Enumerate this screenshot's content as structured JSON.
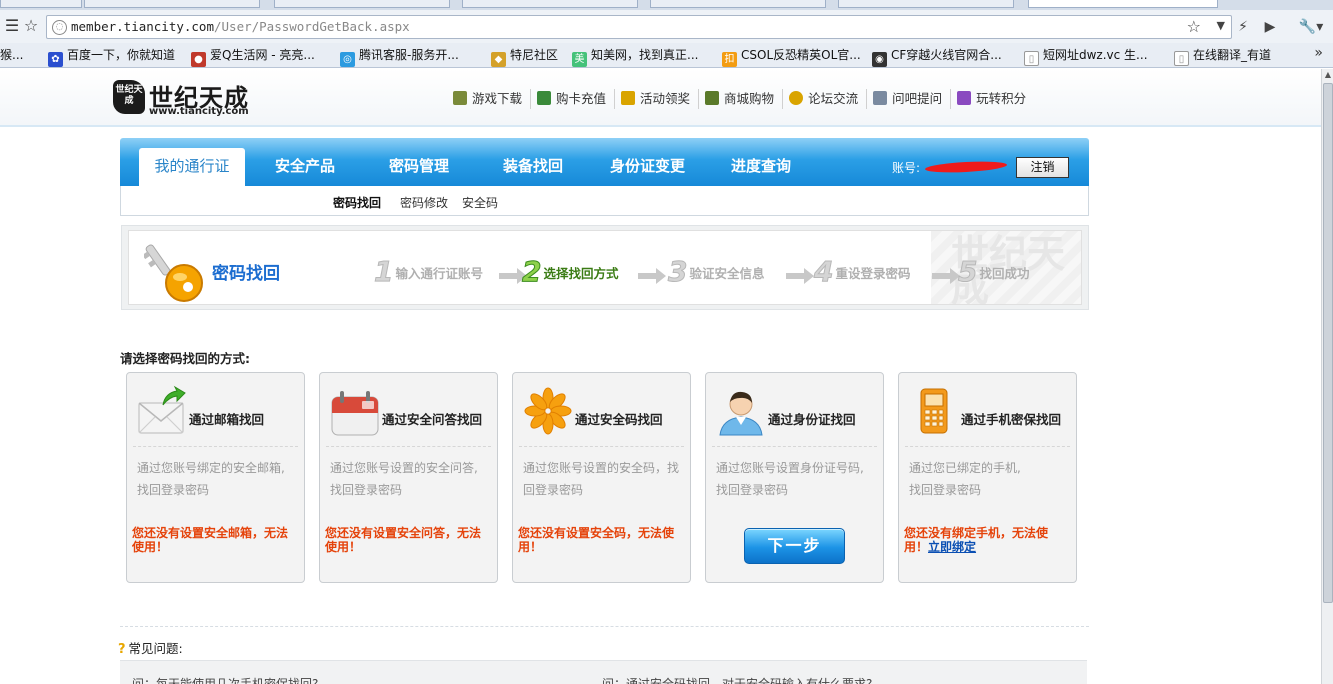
{
  "browser": {
    "url_host": "member.tiancity.com",
    "url_path": "/User/PasswordGetBack.aspx",
    "bookmarks": [
      {
        "label": "猴...",
        "color": "#7a5a2a"
      },
      {
        "label": "百度一下，你就知道",
        "color": "#2b4fcf"
      },
      {
        "label": "爱Q生活网 - 亮亮...",
        "color": "#c0392b"
      },
      {
        "label": "腾讯客服-服务开...",
        "color": "#2c9be0"
      },
      {
        "label": "特尼社区",
        "color": "#d4a12a"
      },
      {
        "label": "知美网，找到真正...",
        "color": "#45c27a"
      },
      {
        "label": "CSOL反恐精英OL官...",
        "color": "#f39c12"
      },
      {
        "label": "CF穿越火线官网合...",
        "color": "#333333"
      },
      {
        "label": "短网址dwz.vc 生...",
        "color": "#cccccc"
      },
      {
        "label": "在线翻译_有道",
        "color": "#cccccc"
      }
    ]
  },
  "site": {
    "logo_name": "世纪天成",
    "logo_domain": "www.tiancity.com",
    "logo_seal": "世纪天成",
    "topnav": [
      {
        "label": "游戏下载",
        "color": "#7a8a3a"
      },
      {
        "label": "购卡充值",
        "color": "#3a8a3a"
      },
      {
        "label": "活动领奖",
        "color": "#d9a400"
      },
      {
        "label": "商城购物",
        "color": "#5a7a2a"
      },
      {
        "label": "论坛交流",
        "color": "#d9a400"
      },
      {
        "label": "问吧提问",
        "color": "#7a8aa0"
      },
      {
        "label": "玩转积分",
        "color": "#8a4ac0"
      }
    ]
  },
  "mainnav": {
    "active": "我的通行证",
    "tabs": [
      "安全产品",
      "密码管理",
      "装备找回",
      "身份证变更",
      "进度查询"
    ],
    "account_label": "账号:",
    "logout": "注销"
  },
  "subnav": {
    "items": [
      "密码找回",
      "密码修改",
      "安全码"
    ]
  },
  "steps": {
    "title": "密码找回",
    "watermark": "世纪天成",
    "items": [
      {
        "num": "1",
        "label": "输入通行证账号",
        "active": false
      },
      {
        "num": "2",
        "label": "选择找回方式",
        "active": true
      },
      {
        "num": "3",
        "label": "验证安全信息",
        "active": false
      },
      {
        "num": "4",
        "label": "重设登录密码",
        "active": false
      },
      {
        "num": "5",
        "label": "找回成功",
        "active": false
      }
    ]
  },
  "choose_prompt": "请选择密码找回的方式:",
  "methods": [
    {
      "title": "通过邮箱找回",
      "desc1": "通过您账号绑定的安全邮箱,",
      "desc2": "找回登录密码",
      "warn": "您还没有设置安全邮箱，无法使用！",
      "icon": "mail-icon"
    },
    {
      "title": "通过安全问答找回",
      "desc1": "通过您账号设置的安全问答,",
      "desc2": "找回登录密码",
      "warn": "您还没有设置安全问答，无法使用！",
      "icon": "calendar-icon"
    },
    {
      "title": "通过安全码找回",
      "desc1": "通过您账号设置的安全码，找",
      "desc2": "回登录密码",
      "warn": "您还没有设置安全码，无法使用！",
      "icon": "asterisk-icon"
    },
    {
      "title": "通过身份证找回",
      "desc1": "通过您账号设置身份证号码,",
      "desc2": "找回登录密码",
      "button": "下一步",
      "icon": "user-icon"
    },
    {
      "title": "通过手机密保找回",
      "desc1": "通过您已绑定的手机,",
      "desc2": "找回登录密码",
      "warn": "您还没有绑定手机，无法使用！",
      "link": "立即绑定",
      "icon": "phone-icon"
    }
  ],
  "faq": {
    "heading": "常见问题:",
    "q1": "问：每天能使用几次手机密保找回?",
    "q2": "问：通过安全码找回，对于安全码输入有什么要求?"
  }
}
